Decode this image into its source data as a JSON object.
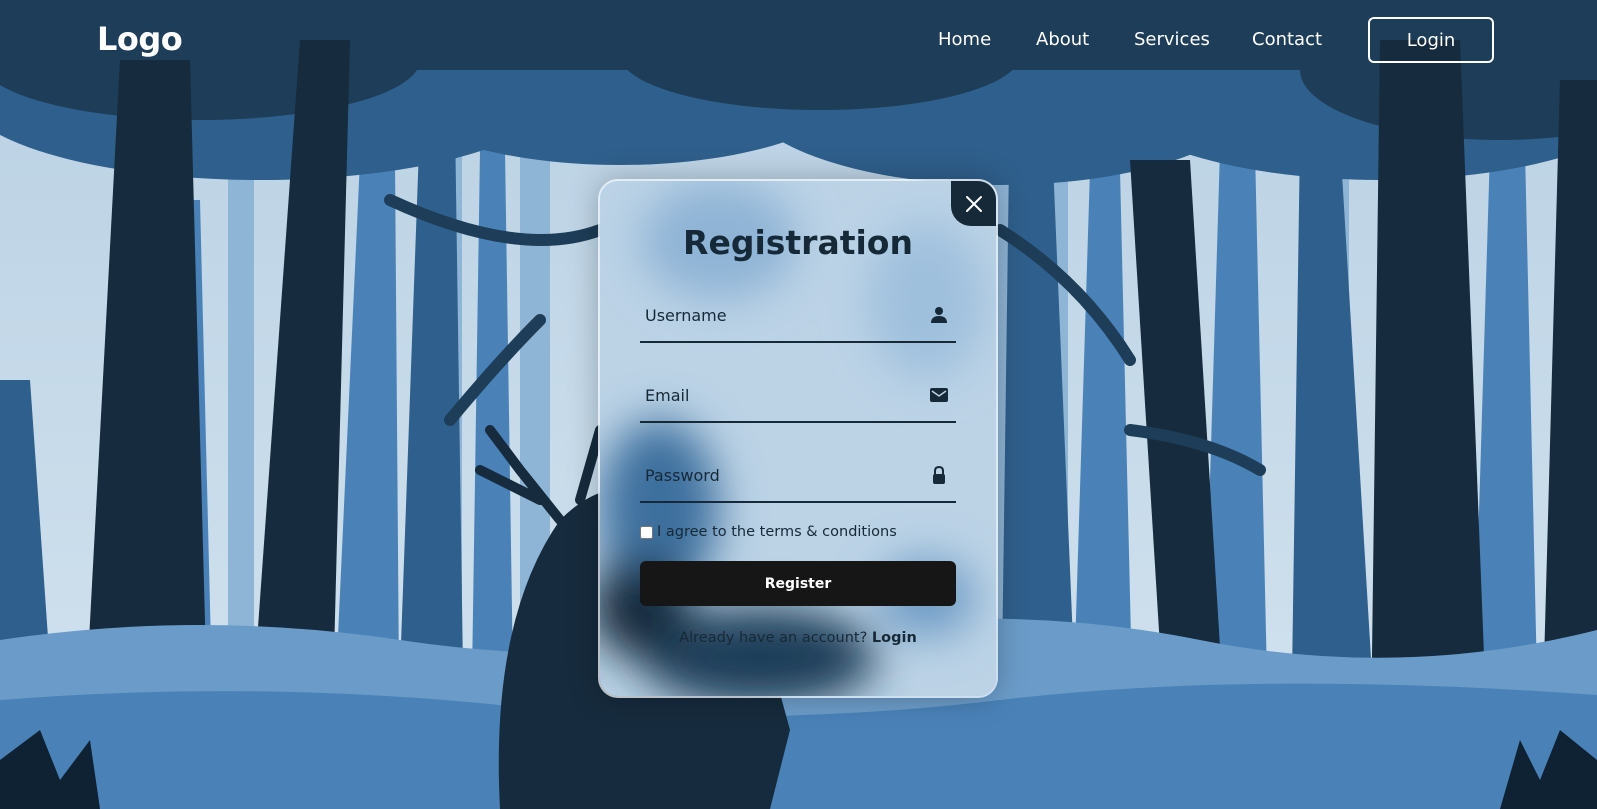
{
  "header": {
    "logo": "Logo",
    "nav": [
      "Home",
      "About",
      "Services",
      "Contact"
    ],
    "login_label": "Login"
  },
  "modal": {
    "title": "Registration",
    "username_placeholder": "Username",
    "email_placeholder": "Email",
    "password_placeholder": "Password",
    "terms_label": "I agree to the terms & conditions",
    "register_label": "Register",
    "already_text": "Already have an account?",
    "login_link": "Login",
    "icons": {
      "close": "close-icon",
      "username": "person-icon",
      "email": "mail-icon",
      "password": "lock-icon"
    }
  },
  "colors": {
    "dark": "#162938",
    "button": "#161616",
    "sky": "#c9dcea"
  }
}
